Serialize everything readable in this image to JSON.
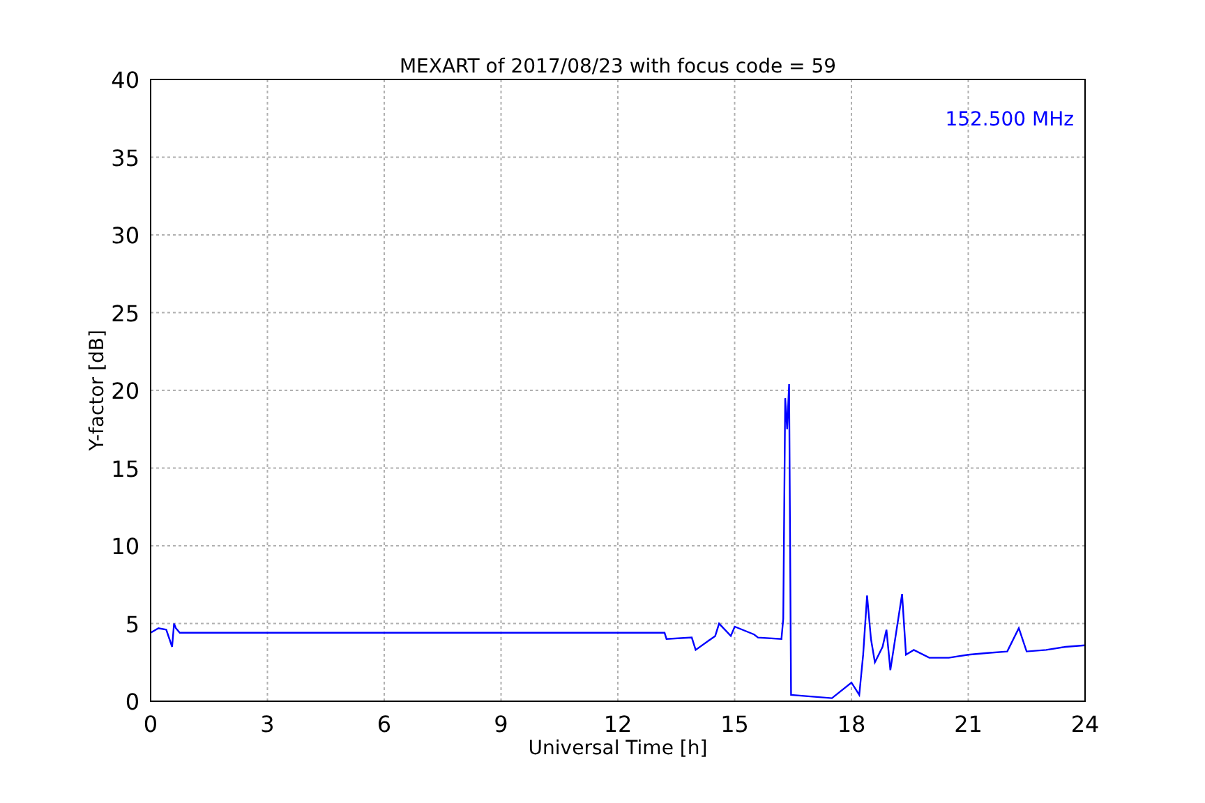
{
  "chart_data": {
    "type": "line",
    "title": "MEXART of 2017/08/23 with focus code = 59",
    "xlabel": "Universal Time [h]",
    "ylabel": "Y-factor [dB]",
    "x": [
      0,
      0.2,
      0.4,
      0.55,
      0.6,
      0.65,
      0.75,
      0.8,
      13.2,
      13.25,
      13.9,
      14.0,
      14.5,
      14.6,
      14.9,
      15.0,
      15.5,
      15.6,
      16.2,
      16.25,
      16.3,
      16.35,
      16.4,
      16.45,
      17.5,
      18.0,
      18.2,
      18.3,
      18.4,
      18.5,
      18.6,
      18.8,
      18.9,
      19.0,
      19.3,
      19.4,
      19.6,
      20.0,
      20.5,
      21.0,
      21.5,
      22.0,
      22.3,
      22.5,
      23.0,
      23.5,
      24
    ],
    "series": [
      {
        "name": "152.500 MHz",
        "color": "#0000ff",
        "values": [
          4.4,
          4.7,
          4.6,
          3.5,
          5.0,
          4.7,
          4.4,
          4.4,
          4.4,
          4.0,
          4.1,
          3.3,
          4.2,
          5.0,
          4.2,
          4.8,
          4.3,
          4.1,
          4.0,
          5.3,
          19.5,
          17.5,
          20.4,
          0.4,
          0.2,
          1.2,
          0.4,
          3.0,
          6.8,
          4.0,
          2.5,
          3.5,
          4.6,
          2.0,
          6.9,
          3.0,
          3.3,
          2.8,
          2.8,
          3.0,
          3.1,
          3.2,
          4.7,
          3.2,
          3.3,
          3.5,
          3.6
        ]
      }
    ],
    "xlim": [
      0,
      24
    ],
    "ylim": [
      0,
      40
    ],
    "xticks": [
      0,
      3,
      6,
      9,
      12,
      15,
      18,
      21,
      24
    ],
    "yticks": [
      0,
      5,
      10,
      15,
      20,
      25,
      30,
      35,
      40
    ],
    "grid": true
  }
}
